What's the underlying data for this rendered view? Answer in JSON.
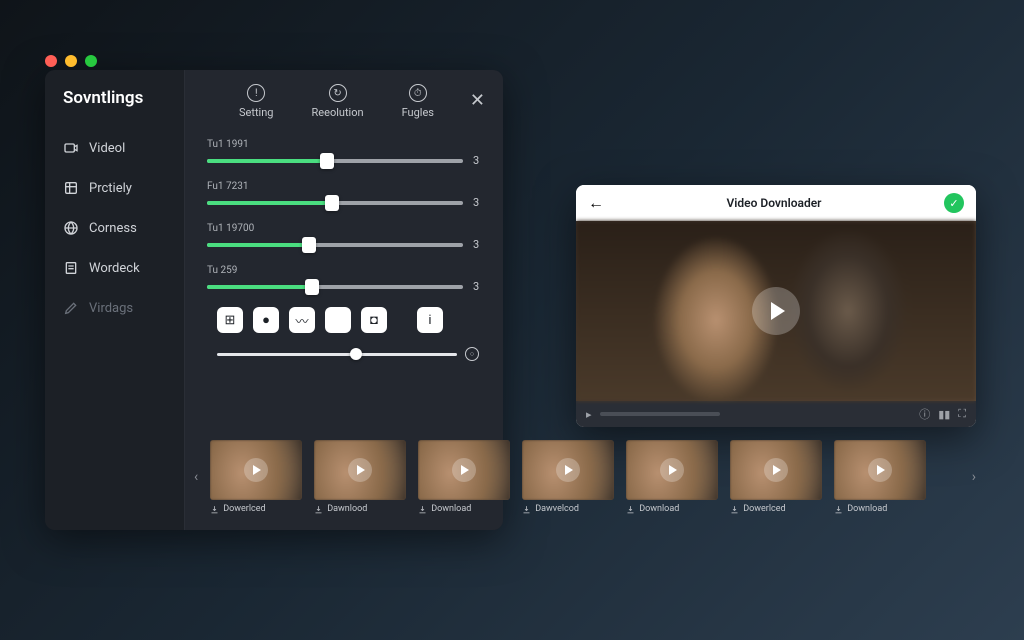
{
  "traffic_lights": [
    "red",
    "yellow",
    "green"
  ],
  "sidebar": {
    "title": "Sovntlings",
    "items": [
      {
        "icon": "video",
        "label": "Videol"
      },
      {
        "icon": "layers",
        "label": "Prctiely"
      },
      {
        "icon": "globe",
        "label": "Corness"
      },
      {
        "icon": "page",
        "label": "Wordeck"
      },
      {
        "icon": "pencil",
        "label": "Virdags"
      }
    ]
  },
  "tabs": [
    {
      "icon": "!",
      "label": "Setting"
    },
    {
      "icon": "↻",
      "label": "Reeolution"
    },
    {
      "icon": "⏱",
      "label": "Fugles"
    }
  ],
  "sliders": [
    {
      "label": "Tu1 1991",
      "percent": 47,
      "value": "3"
    },
    {
      "label": "Fu1 7231",
      "percent": 49,
      "value": "3"
    },
    {
      "label": "Tu1 19700",
      "percent": 40,
      "value": "3"
    },
    {
      "label": "Tu 259",
      "percent": 41,
      "value": "3"
    }
  ],
  "icon_buttons": [
    "grid",
    "stop",
    "chart",
    "apple",
    "box",
    "info"
  ],
  "bottom_slider": {
    "percent": 58
  },
  "preview": {
    "title": "Video Dovnloader",
    "controls": [
      "info",
      "columns",
      "expand"
    ]
  },
  "thumbnails": [
    {
      "label": "Dowerlced"
    },
    {
      "label": "Dawnlood"
    },
    {
      "label": "Download"
    },
    {
      "label": "Dawvelcod"
    },
    {
      "label": "Download"
    },
    {
      "label": "Dowerlced"
    },
    {
      "label": "Download"
    }
  ]
}
